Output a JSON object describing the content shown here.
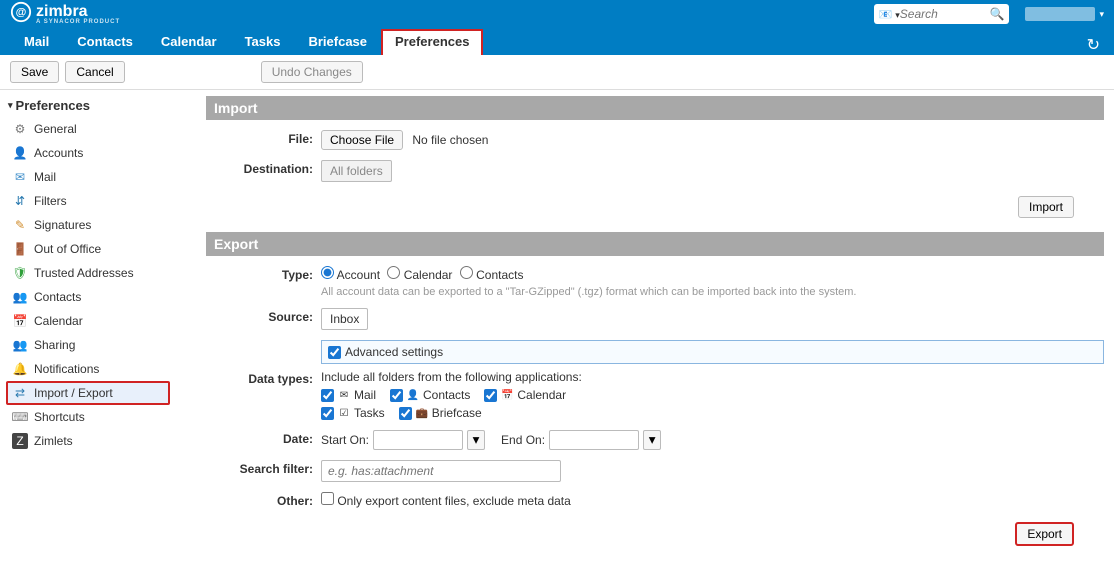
{
  "brand": {
    "name": "zimbra",
    "sub": "A SYNACOR PRODUCT"
  },
  "search": {
    "placeholder": "Search"
  },
  "nav": [
    "Mail",
    "Contacts",
    "Calendar",
    "Tasks",
    "Briefcase",
    "Preferences"
  ],
  "nav_active_index": 5,
  "toolbar": {
    "save": "Save",
    "cancel": "Cancel",
    "undo": "Undo Changes"
  },
  "sidebar": {
    "heading": "Preferences",
    "items": [
      "General",
      "Accounts",
      "Mail",
      "Filters",
      "Signatures",
      "Out of Office",
      "Trusted Addresses",
      "Contacts",
      "Calendar",
      "Sharing",
      "Notifications",
      "Import / Export",
      "Shortcuts",
      "Zimlets"
    ],
    "selected_index": 11
  },
  "import": {
    "title": "Import",
    "file_label": "File:",
    "choose_btn": "Choose File",
    "file_status": "No file chosen",
    "dest_label": "Destination:",
    "dest_value": "All folders",
    "action": "Import"
  },
  "export": {
    "title": "Export",
    "type_label": "Type:",
    "types": [
      "Account",
      "Calendar",
      "Contacts"
    ],
    "type_selected_index": 0,
    "type_hint": "All account data can be exported to a \"Tar-GZipped\" (.tgz) format which can be imported back into the system.",
    "source_label": "Source:",
    "source_value": "Inbox",
    "adv_label": "Advanced settings",
    "adv_checked": true,
    "data_types_label": "Data types:",
    "data_types_hint": "Include all folders from the following applications:",
    "data_types": [
      {
        "label": "Mail",
        "checked": true
      },
      {
        "label": "Contacts",
        "checked": true
      },
      {
        "label": "Calendar",
        "checked": true
      },
      {
        "label": "Tasks",
        "checked": true
      },
      {
        "label": "Briefcase",
        "checked": true
      }
    ],
    "date_label": "Date:",
    "start_on": "Start On:",
    "end_on": "End On:",
    "search_label": "Search filter:",
    "search_placeholder": "e.g. has:attachment",
    "other_label": "Other:",
    "other_option": "Only export content files, exclude meta data",
    "action": "Export"
  }
}
